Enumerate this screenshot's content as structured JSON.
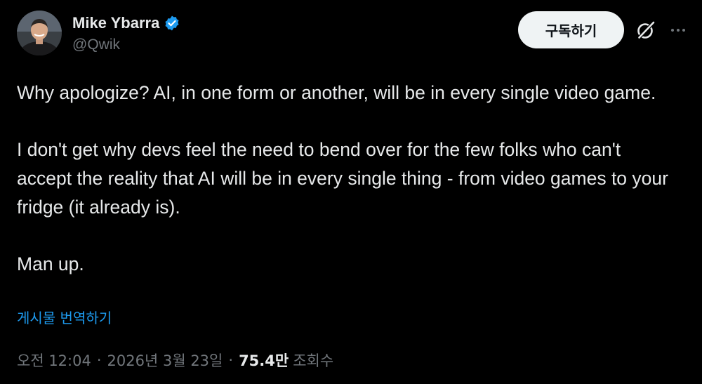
{
  "author": {
    "display_name": "Mike Ybarra",
    "handle": "@Qwik",
    "verified": true
  },
  "actions": {
    "subscribe_label": "구독하기",
    "grok_icon": "grok-icon",
    "more_icon": "more-icon"
  },
  "tweet": {
    "paragraphs": [
      "Why apologize? AI, in one form or another, will be in every single video game.",
      "I don't get why devs feel the need to bend over for the few folks who can't accept the reality that AI will be in every single thing - from video games to your fridge (it already is).",
      "Man up."
    ],
    "translate_label": "게시물 번역하기"
  },
  "meta": {
    "time": "오전 12:04",
    "separator": "·",
    "date": "2026년 3월 23일",
    "views_count": "75.4만",
    "views_label": "조회수"
  },
  "colors": {
    "background": "#000000",
    "text_primary": "#e7e9ea",
    "text_secondary": "#71767b",
    "link": "#1d9bf0",
    "verified_badge": "#1d9bf0",
    "button_bg": "#eff3f4"
  }
}
